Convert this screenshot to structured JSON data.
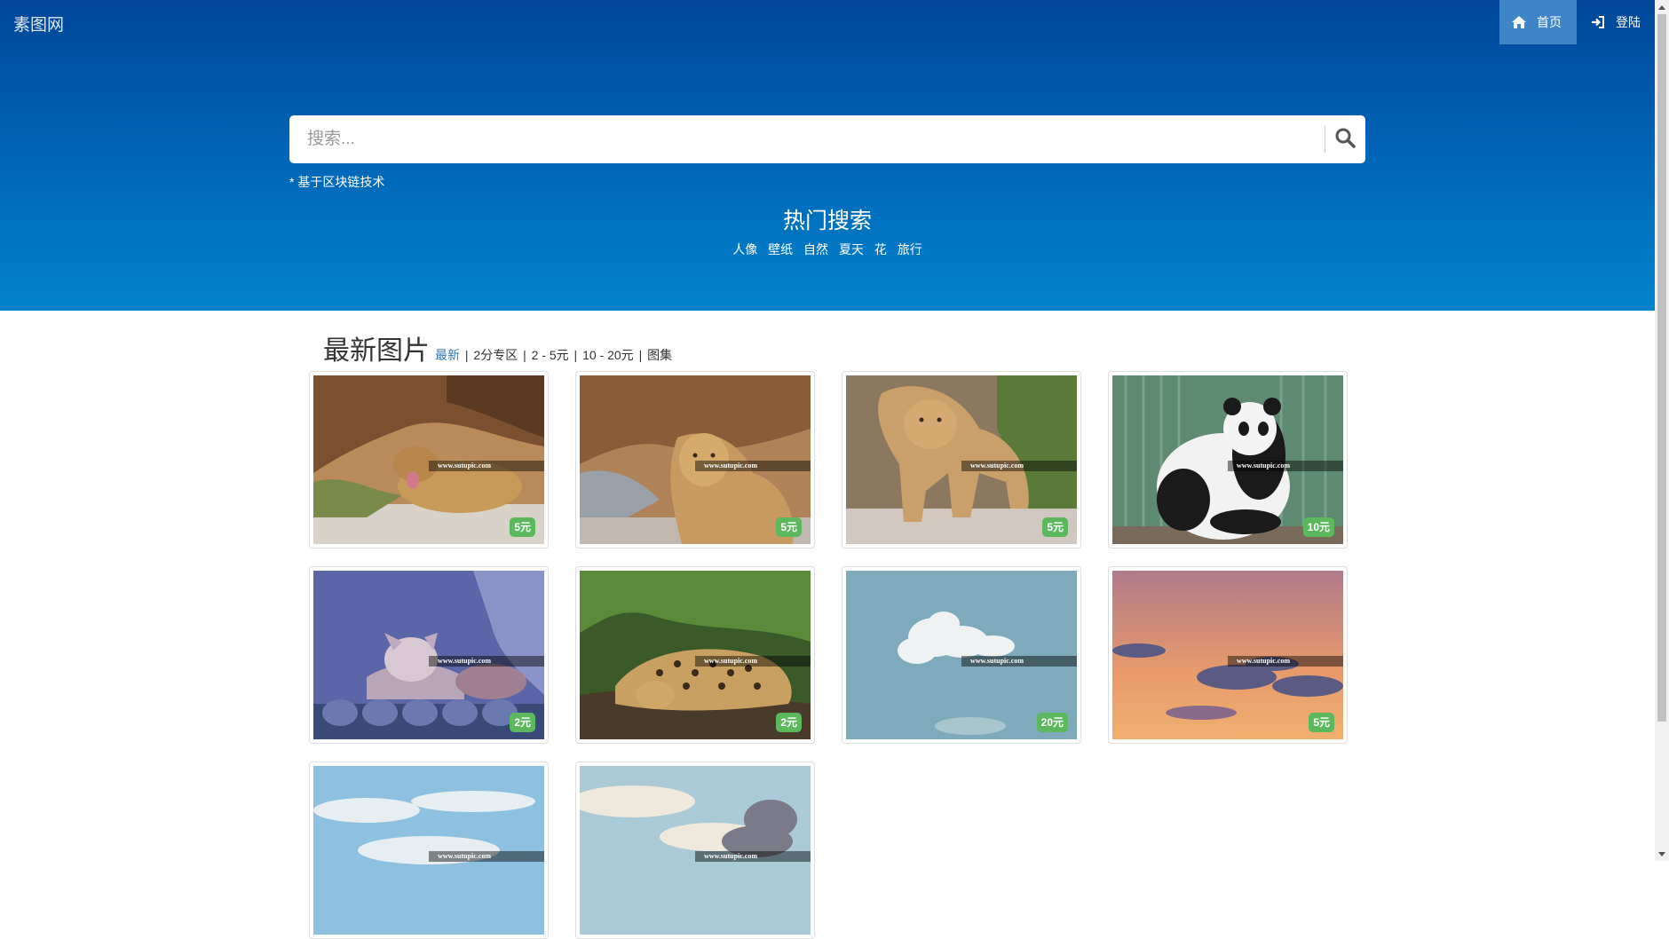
{
  "brand": "素图网",
  "nav": [
    {
      "label": "首页",
      "icon": "home-icon",
      "active": true
    },
    {
      "label": "登陆",
      "icon": "login-icon",
      "active": false
    }
  ],
  "search": {
    "placeholder": "搜索...",
    "icon": "search-icon"
  },
  "note": "* 基于区块链技术",
  "hot": {
    "title": "热门搜索",
    "tags": [
      "人像",
      "壁纸",
      "自然",
      "夏天",
      "花",
      "旅行"
    ]
  },
  "section": {
    "title": "最新图片",
    "filters": [
      {
        "label": "最新",
        "active": true
      },
      {
        "label": "2分专区",
        "active": false
      },
      {
        "label": "2 - 5元",
        "active": false
      },
      {
        "label": "10 - 20元",
        "active": false
      },
      {
        "label": "图集",
        "active": false
      }
    ],
    "separator": "|"
  },
  "watermark": "www.sutupic.com",
  "images": [
    {
      "subject": "lioness-lying",
      "price": "5元"
    },
    {
      "subject": "lioness-sitting",
      "price": "5元"
    },
    {
      "subject": "lioness-walking",
      "price": "5元"
    },
    {
      "subject": "panda",
      "price": "10元"
    },
    {
      "subject": "coyote",
      "price": "2元"
    },
    {
      "subject": "leopard",
      "price": "2元"
    },
    {
      "subject": "cloud-sky",
      "price": "20元"
    },
    {
      "subject": "sunset-sky",
      "price": "5元"
    },
    {
      "subject": "blue-sky",
      "price": ""
    },
    {
      "subject": "cloudy-sky",
      "price": ""
    }
  ],
  "colors": {
    "price_badge": "#5cb85c",
    "link_active": "#337ab7",
    "nav_active": "#3e86c7"
  }
}
